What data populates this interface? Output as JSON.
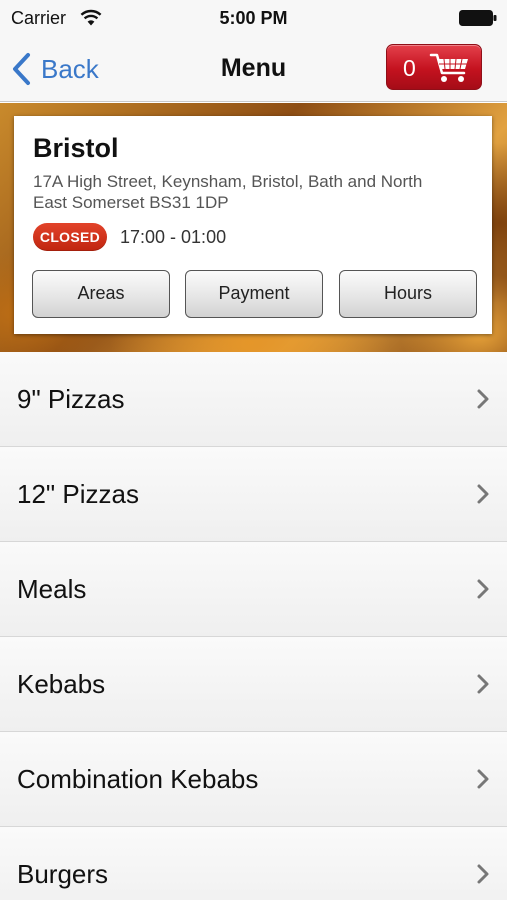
{
  "status_bar": {
    "carrier": "Carrier",
    "time": "5:00 PM",
    "icons": [
      "wifi-icon",
      "battery-icon"
    ]
  },
  "nav": {
    "back_label": "Back",
    "title": "Menu",
    "cart_count": "0",
    "icons": [
      "back-chevron-icon",
      "shopping-cart-icon"
    ]
  },
  "store": {
    "name": "Bristol",
    "address": "17A High Street, Keynsham, Bristol, Bath and North East Somerset BS31 1DP",
    "status": "CLOSED",
    "hours": "17:00 - 01:00",
    "buttons": {
      "areas": "Areas",
      "payment": "Payment",
      "hours": "Hours"
    }
  },
  "menu": {
    "items": [
      {
        "label": "9\" Pizzas"
      },
      {
        "label": "12\" Pizzas"
      },
      {
        "label": "Meals"
      },
      {
        "label": "Kebabs"
      },
      {
        "label": "Combination Kebabs"
      },
      {
        "label": "Burgers"
      }
    ]
  },
  "colors": {
    "link_blue": "#3a78c9",
    "cart_red": "#c4121f",
    "closed_red": "#d0321c"
  }
}
